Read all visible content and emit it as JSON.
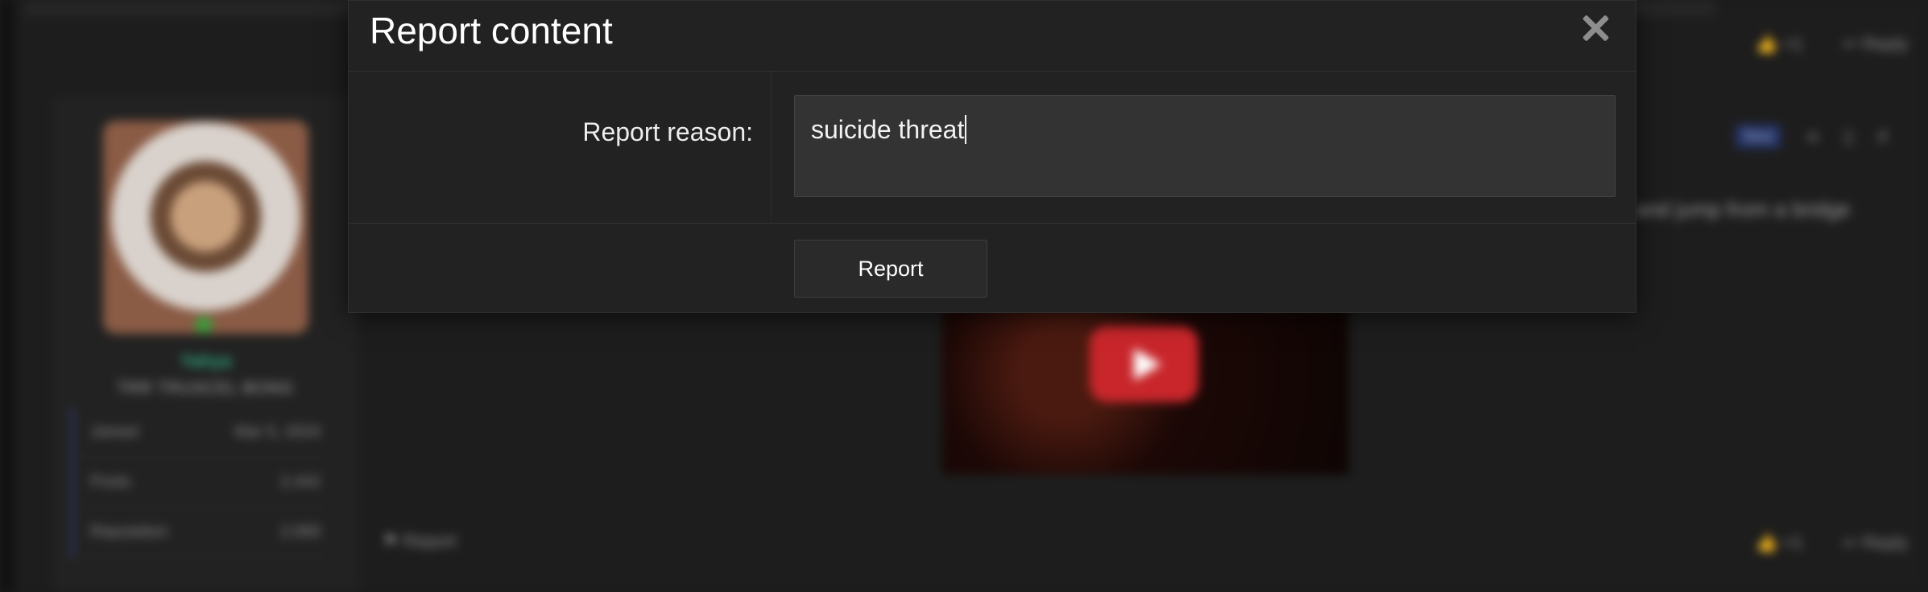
{
  "background": {
    "user": {
      "name": "Yahya",
      "title": "TRR TRUSCEL BONG",
      "stats": [
        {
          "label": "Joined",
          "value": "Mar 5, 2024"
        },
        {
          "label": "Posts",
          "value": "2,442"
        },
        {
          "label": "Reputation",
          "value": "2,060"
        }
      ]
    },
    "post": {
      "new_badge": "New",
      "text_fragment": "and jump from a bridge",
      "like_count": "+1",
      "reply_label": "Reply",
      "report_label": "Report"
    }
  },
  "dialog": {
    "title": "Report content",
    "reason_label": "Report reason:",
    "reason_value": "suicide threat",
    "submit_label": "Report"
  }
}
